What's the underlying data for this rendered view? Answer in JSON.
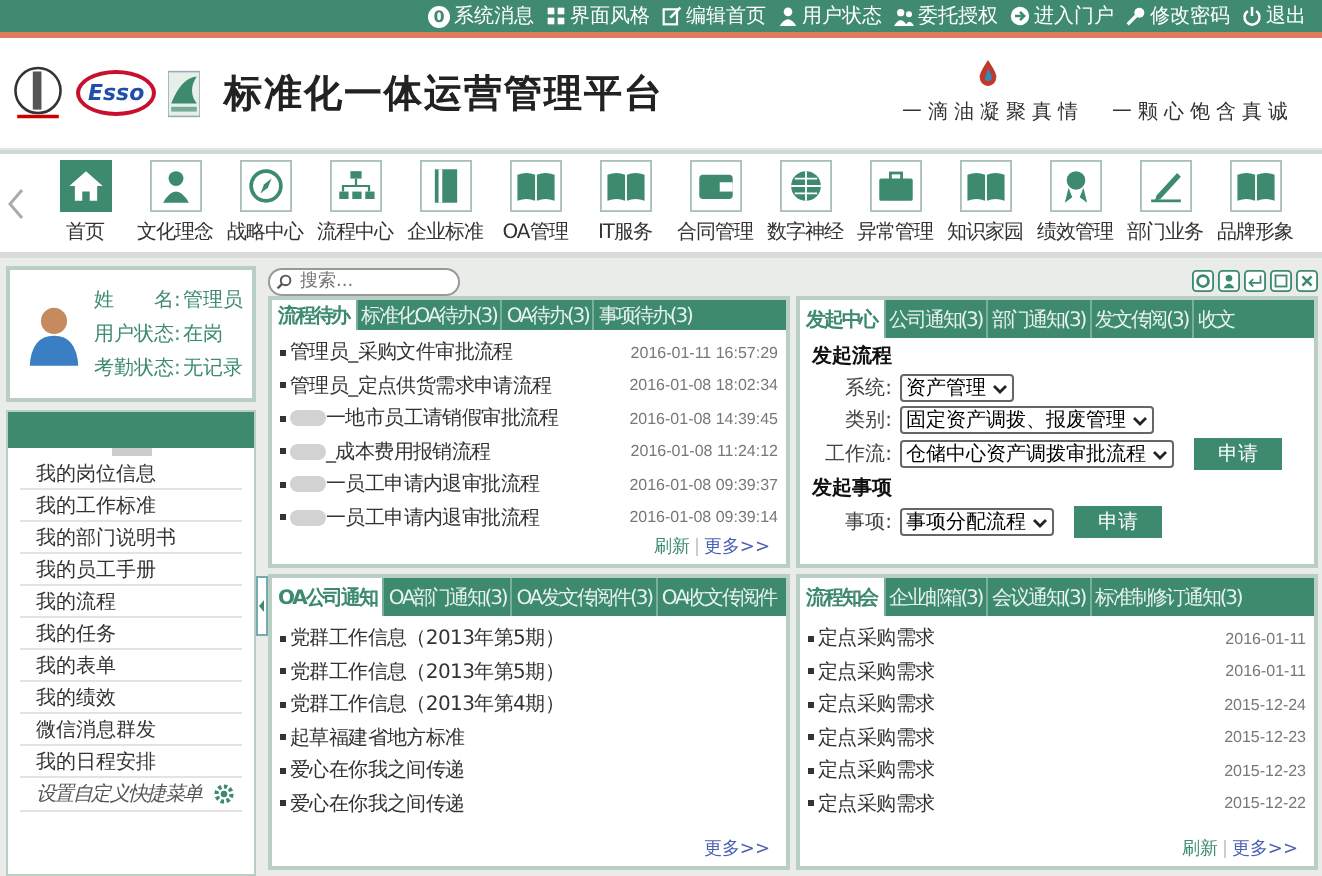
{
  "top_bar": {
    "links": [
      {
        "label": "系统消息",
        "badge": "0"
      },
      {
        "label": "界面风格"
      },
      {
        "label": "编辑首页"
      },
      {
        "label": "用户状态"
      },
      {
        "label": "委托授权"
      },
      {
        "label": "进入门户"
      },
      {
        "label": "修改密码"
      },
      {
        "label": "退出"
      }
    ]
  },
  "header": {
    "logo_text": "Esso",
    "title": "标准化一体运营管理平台",
    "slogan": [
      "一滴油凝聚真情",
      "一颗心饱含真诚"
    ]
  },
  "nav": [
    {
      "label": "首页",
      "selected": true
    },
    {
      "label": "文化理念",
      "selected": false
    },
    {
      "label": "战略中心",
      "selected": false
    },
    {
      "label": "流程中心",
      "selected": false
    },
    {
      "label": "企业标准",
      "selected": false
    },
    {
      "label": "OA管理",
      "selected": false
    },
    {
      "label": "IT服务",
      "selected": false
    },
    {
      "label": "合同管理",
      "selected": false
    },
    {
      "label": "数字神经",
      "selected": false
    },
    {
      "label": "异常管理",
      "selected": false
    },
    {
      "label": "知识家园",
      "selected": false
    },
    {
      "label": "绩效管理",
      "selected": false
    },
    {
      "label": "部门业务",
      "selected": false
    },
    {
      "label": "品牌形象",
      "selected": false
    }
  ],
  "profile": [
    {
      "label": "姓　　名:",
      "value": "管理员"
    },
    {
      "label": "用户状态:",
      "value": "在岗"
    },
    {
      "label": "考勤状态:",
      "value": "无记录"
    }
  ],
  "sidebar": {
    "items": [
      "我的岗位信息",
      "我的工作标准",
      "我的部门说明书",
      "我的员工手册",
      "我的流程",
      "我的任务",
      "我的表单",
      "我的绩效",
      "微信消息群发",
      "我的日程安排"
    ],
    "custom_link": "设置自定义快捷菜单"
  },
  "search": {
    "placeholder": "搜索..."
  },
  "panels": [
    {
      "tabs": [
        {
          "label": "流程待办",
          "selected": true
        },
        {
          "label": "标准化OA待办(3)",
          "selected": false
        },
        {
          "label": "OA待办(3)",
          "selected": false
        },
        {
          "label": "事项待办(3)",
          "selected": false
        }
      ],
      "rows": [
        {
          "title": "管理员_采购文件审批流程",
          "date": "2016-01-11 16:57:29",
          "redacted": false
        },
        {
          "title": "管理员_定点供货需求申请流程",
          "date": "2016-01-08 18:02:34",
          "redacted": false
        },
        {
          "title": "一地市员工请销假审批流程",
          "date": "2016-01-08 14:39:45",
          "redacted": true
        },
        {
          "title": "_成本费用报销流程",
          "date": "2016-01-08 11:24:12",
          "redacted": true
        },
        {
          "title": "一员工申请内退审批流程",
          "date": "2016-01-08 09:39:37",
          "redacted": true
        },
        {
          "title": "一员工申请内退审批流程",
          "date": "2016-01-08 09:39:14",
          "redacted": true
        }
      ],
      "footer": [
        "刷新",
        "更多>>"
      ]
    },
    {
      "kind": "form",
      "tabs": [
        {
          "label": "发起中心",
          "selected": true
        },
        {
          "label": "公司通知(3)",
          "selected": false
        },
        {
          "label": "部门通知(3)",
          "selected": false
        },
        {
          "label": "发文传阅(3)",
          "selected": false
        },
        {
          "label": "收文",
          "selected": false
        }
      ],
      "sections": [
        {
          "heading": "发起流程",
          "fields": [
            {
              "label": "系统:",
              "value": "资产管理"
            },
            {
              "label": "类别:",
              "value": "固定资产调拨、报废管理"
            },
            {
              "label": "工作流:",
              "value": "仓储中心资产调拨审批流程",
              "button": "申请"
            }
          ]
        },
        {
          "heading": "发起事项",
          "fields": [
            {
              "label": "事项:",
              "value": "事项分配流程",
              "button": "申请"
            }
          ]
        }
      ]
    },
    {
      "tabs": [
        {
          "label": "OA公司通知",
          "selected": true
        },
        {
          "label": "OA部门通知(3)",
          "selected": false
        },
        {
          "label": "OA发文传阅件(3)",
          "selected": false
        },
        {
          "label": "OA收文传阅件",
          "selected": false
        }
      ],
      "rows": [
        {
          "title": "党群工作信息（2013年第5期）"
        },
        {
          "title": "党群工作信息（2013年第5期）"
        },
        {
          "title": "党群工作信息（2013年第4期）"
        },
        {
          "title": "起草福建省地方标准"
        },
        {
          "title": "爱心在你我之间传递"
        },
        {
          "title": "爱心在你我之间传递"
        }
      ],
      "footer": [
        "更多>>"
      ]
    },
    {
      "tabs": [
        {
          "label": "流程知会",
          "selected": true
        },
        {
          "label": "企业邮箱(3)",
          "selected": false
        },
        {
          "label": "会议通知(3)",
          "selected": false
        },
        {
          "label": "标准制修订通知(3)",
          "selected": false
        }
      ],
      "rows": [
        {
          "title": "定点采购需求",
          "date": "2016-01-11"
        },
        {
          "title": "定点采购需求",
          "date": "2016-01-11"
        },
        {
          "title": "定点采购需求",
          "date": "2015-12-24"
        },
        {
          "title": "定点采购需求",
          "date": "2015-12-23"
        },
        {
          "title": "定点采购需求",
          "date": "2015-12-23"
        },
        {
          "title": "定点采购需求",
          "date": "2015-12-22"
        }
      ],
      "footer": [
        "刷新",
        "更多>>"
      ]
    }
  ]
}
